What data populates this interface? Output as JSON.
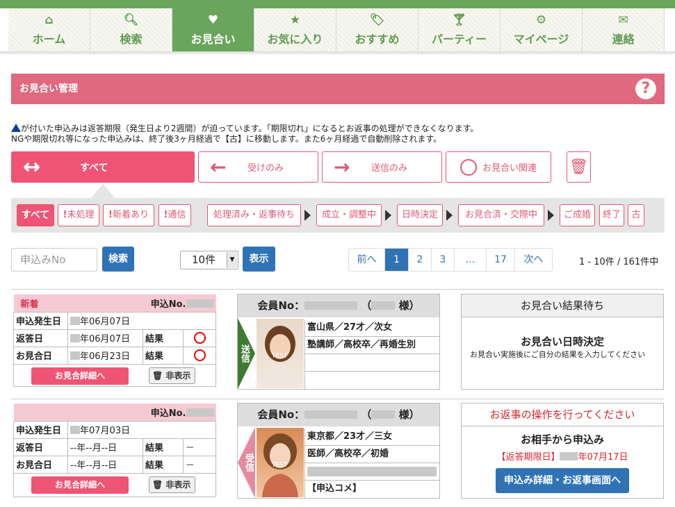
{
  "nav": [
    {
      "icon": "⌂",
      "label": "ホーム",
      "active": false
    },
    {
      "icon": "🔍︎",
      "label": "検索",
      "active": false
    },
    {
      "icon": "♥",
      "label": "お見合い",
      "active": true
    },
    {
      "icon": "★",
      "label": "お気に入り",
      "active": false
    },
    {
      "icon": "🏷︎",
      "label": "おすすめ",
      "active": false
    },
    {
      "icon": "🍸︎",
      "label": "パーティー",
      "active": false
    },
    {
      "icon": "⚙",
      "label": "マイページ",
      "active": false
    },
    {
      "icon": "✉",
      "label": "連絡",
      "active": false
    }
  ],
  "header": {
    "title": "お見合い管理",
    "help": "?"
  },
  "notice": {
    "line1": "が付いた申込みは返答期限（発生日より2週間）が迫っています。「期限切れ」になるとお返事の処理ができなくなります。",
    "line2": "NGや期限切れ等になった申込みは、終了後3ヶ月経過で【古】に移動します。また6ヶ月経過で自動削除されます。"
  },
  "filters": {
    "all": "すべて",
    "received": "受けのみ",
    "sent": "送信のみ",
    "related": "お見合い関連"
  },
  "status": {
    "all": "すべて",
    "unprocessed": "未処理",
    "new_arrival": "新着あり",
    "notice": "通信",
    "processed": "処理済み・返事待ち",
    "adjusting": "成立・調整中",
    "date_set": "日時決定",
    "dating": "お見合済・交際中",
    "married": "ご成婚",
    "ended": "終了",
    "old": "古"
  },
  "search": {
    "placeholder": "申込みNo",
    "button": "検索"
  },
  "per_page": {
    "value": "10件",
    "button": "表示"
  },
  "pager": {
    "prev": "前へ",
    "pages": [
      "1",
      "2",
      "3",
      "…",
      "17"
    ],
    "next": "次へ",
    "count": "1 - 10件 / 161件中"
  },
  "records": [
    {
      "badge": "新着",
      "no_label": "申込No.",
      "rows": [
        {
          "label": "申込発生日",
          "value": "年06月07日"
        },
        {
          "label": "返答日",
          "value": "年06月07日",
          "result_label": "結果"
        },
        {
          "label": "お見合日",
          "value": "年06月23日",
          "result_label": "結果"
        }
      ],
      "detail_button": "お見合詳細へ",
      "hide_button": "非表示",
      "member": {
        "label": "会員No：",
        "suffix": "様）",
        "direction": "送信",
        "photo_text": "TEST",
        "details": [
          "富山県／27才／次女",
          "塾講師／高校卒／再婚生別",
          "",
          ""
        ]
      },
      "result": {
        "title": "お見合い結果待ち",
        "heading": "お見合い日時決定",
        "text": "お見合い実施後にご自分の結果を入力してください"
      }
    },
    {
      "badge": "",
      "no_label": "申込No.",
      "rows": [
        {
          "label": "申込発生日",
          "value": "年07月03日"
        },
        {
          "label": "返答日",
          "value": "--年--月--日",
          "result_label": "結果",
          "result": "－"
        },
        {
          "label": "お見合日",
          "value": "--年--月--日",
          "result_label": "結果",
          "result": "－"
        }
      ],
      "detail_button": "お見合詳細へ",
      "hide_button": "非表示",
      "member": {
        "label": "会員No：",
        "suffix": "様）",
        "direction": "受信",
        "photo_text": "TEST",
        "details": [
          "東京都／23才／三女",
          "医師／高校卒／初婚",
          "",
          "【申込コメ】"
        ]
      },
      "result": {
        "title": "お返事の操作を行ってください",
        "heading": "お相手から申込み",
        "deadline": "【返答期限日】",
        "deadline_date": "年07月17日",
        "button": "申込み詳細・お返事画面へ"
      }
    }
  ],
  "colors": {
    "green": "#6aa55c",
    "pink": "#f05474",
    "header": "#e0687f",
    "blue": "#2f73b5"
  }
}
